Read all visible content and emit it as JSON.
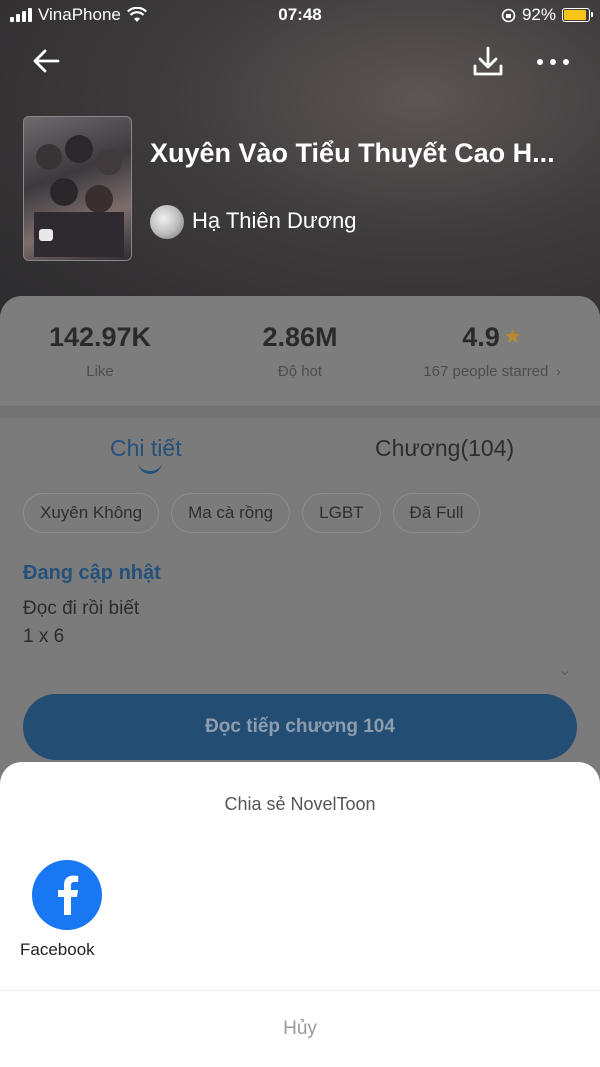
{
  "status_bar": {
    "carrier": "VinaPhone",
    "time": "07:48",
    "battery": "92%",
    "battery_level": 0.92
  },
  "book": {
    "title": "Xuyên Vào Tiểu Thuyết Cao H...",
    "author": "Hạ Thiên Dương"
  },
  "stats": {
    "likes": {
      "value": "142.97K",
      "label": "Like"
    },
    "hot": {
      "value": "2.86M",
      "label": "Độ hot"
    },
    "rating": {
      "value": "4.9",
      "label": "167 people starred"
    }
  },
  "tabs": {
    "detail": "Chi tiết",
    "chapters": "Chương(104)"
  },
  "tags": [
    "Xuyên Không",
    "Ma cà rồng",
    "LGBT",
    "Đã Full"
  ],
  "details": {
    "status": "Đang cập nhật",
    "description_lines": [
      "Đọc đi rồi biết",
      "1 x 6"
    ]
  },
  "read_button": "Đọc tiếp chương 104",
  "share_sheet": {
    "title": "Chia sẻ NovelToon",
    "options": [
      {
        "label": "Facebook",
        "icon": "facebook-icon"
      }
    ],
    "cancel": "Hủy"
  },
  "colors": {
    "accent": "#3d8ee0",
    "facebook": "#1877f2",
    "star": "#e8a93a",
    "battery": "#f5c518"
  }
}
